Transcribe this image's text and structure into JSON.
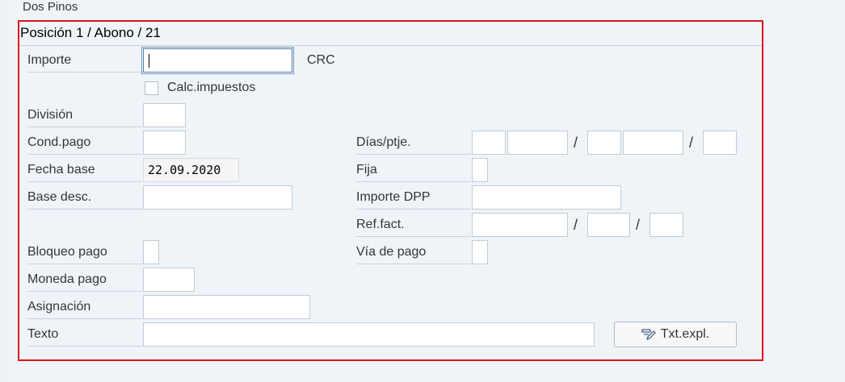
{
  "header": {
    "company": "Dos Pinos"
  },
  "group": {
    "title": "Posición 1 / Abono / 21"
  },
  "fields": {
    "importe_label": "Importe",
    "importe_value": "",
    "importe_currency": "CRC",
    "calc_impuestos_label": "Calc.impuestos",
    "division_label": "División",
    "cond_pago_label": "Cond.pago",
    "fecha_base_label": "Fecha base",
    "fecha_base_value": "22.09.2020",
    "base_desc_label": "Base desc.",
    "bloqueo_pago_label": "Bloqueo pago",
    "moneda_pago_label": "Moneda pago",
    "asignacion_label": "Asignación",
    "texto_label": "Texto",
    "dias_ptje_label": "Días/ptje.",
    "fija_label": "Fija",
    "importe_dpp_label": "Importe DPP",
    "ref_fact_label": "Ref.fact.",
    "via_de_pago_label": "Vía de pago",
    "slash": "/"
  },
  "buttons": {
    "txt_expl_label": "Txt.expl."
  },
  "icons": {
    "txt_expl": "edit-text-icon"
  }
}
